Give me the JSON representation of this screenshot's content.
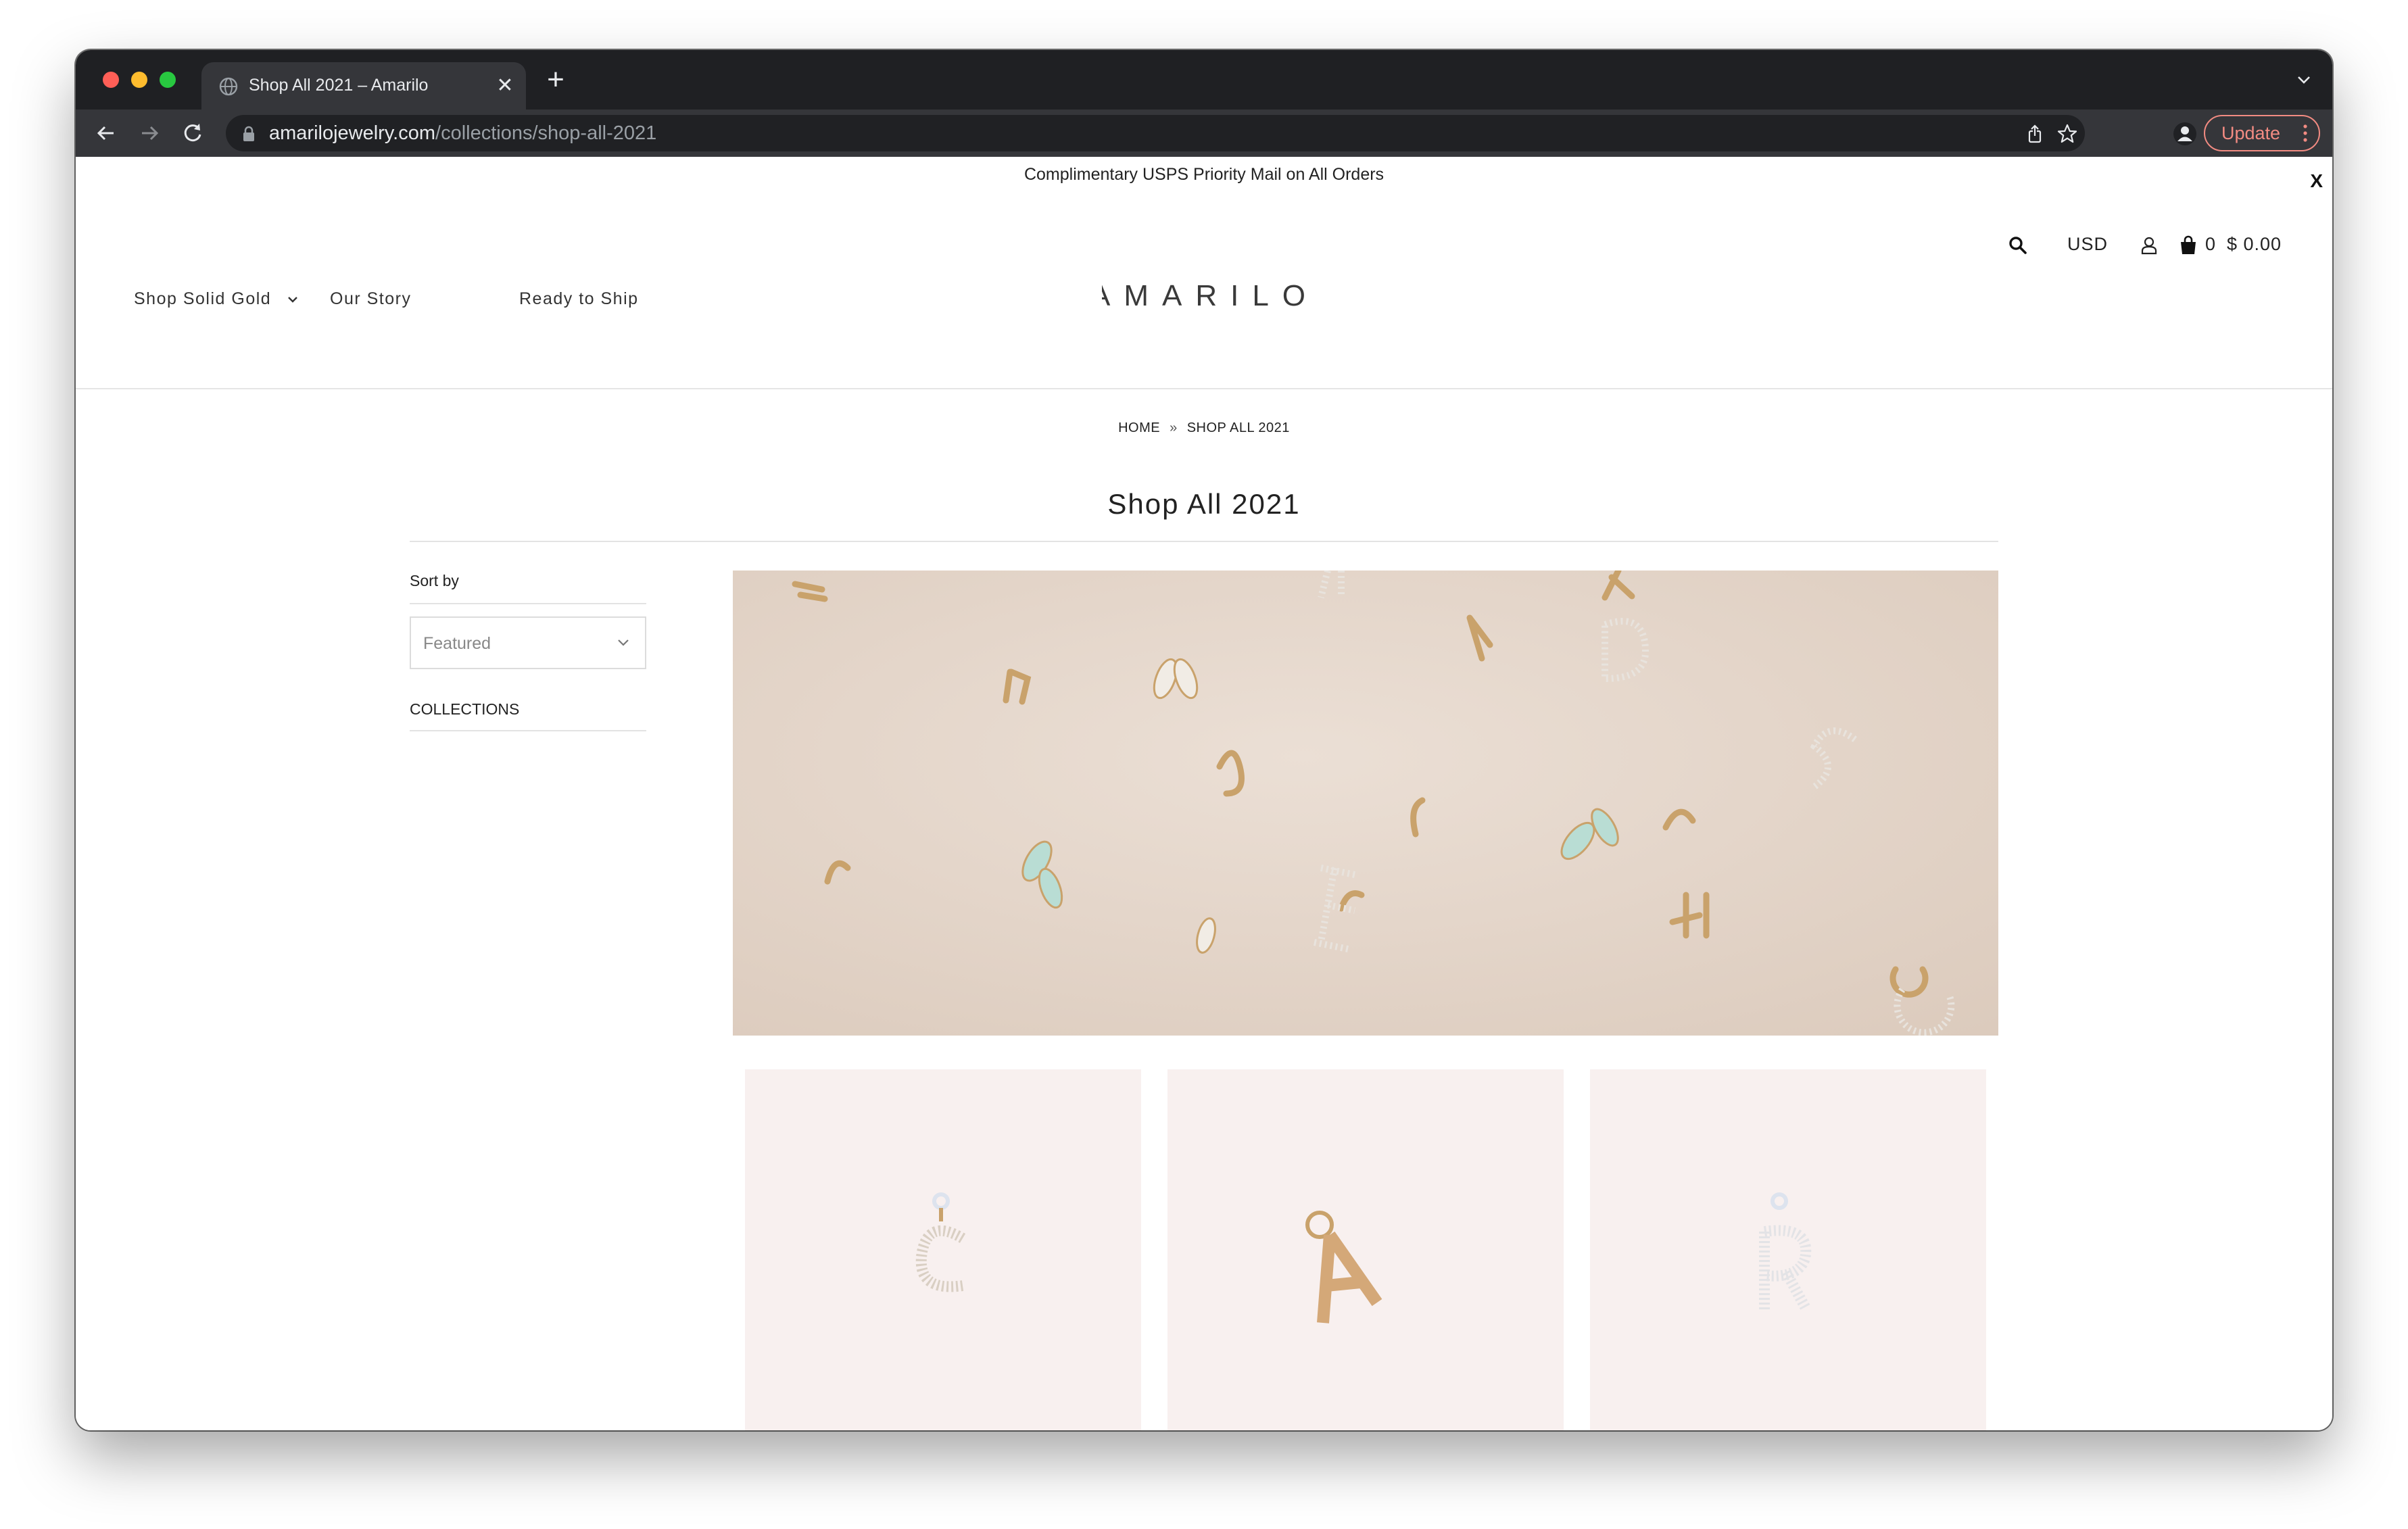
{
  "browser": {
    "tab_title": "Shop All 2021 – Amarilo",
    "tab_close": "✕",
    "new_tab": "+",
    "url_domain": "amarilojewelry.com",
    "url_path": "/collections/shop-all-2021",
    "update_label": "Update"
  },
  "announcement": {
    "text": "Complimentary USPS Priority Mail on All Orders",
    "close": "X"
  },
  "header": {
    "currency": "USD",
    "cart_count": "0",
    "cart_total": "$ 0.00",
    "logo_text": "AMARILO",
    "nav": [
      {
        "label": "Shop Solid Gold",
        "icon": "chevron-down-icon"
      },
      {
        "label": "Our Story"
      },
      {
        "label": "Ready to Ship"
      }
    ]
  },
  "breadcrumb": {
    "home": "HOME",
    "separator": "»",
    "current": "SHOP ALL 2021"
  },
  "collection": {
    "title": "Shop All 2021"
  },
  "sidebar": {
    "sort_label": "Sort by",
    "sort_value": "Featured",
    "collections_label": "COLLECTIONS"
  },
  "products": [
    {
      "letter": "C",
      "image": "pave-diamond-letter-c-charm"
    },
    {
      "letter": "A",
      "image": "gold-letter-a-charm"
    },
    {
      "letter": "R",
      "image": "pave-diamond-letter-r-charm"
    }
  ],
  "colors": {
    "chrome_dark": "#1f2023",
    "chrome_toolbar": "#35363a",
    "update_accent": "#f28b82",
    "banner_bg": "#e6d8cc",
    "product_bg": "#f8f0ef",
    "gold": "#c9a26b"
  }
}
